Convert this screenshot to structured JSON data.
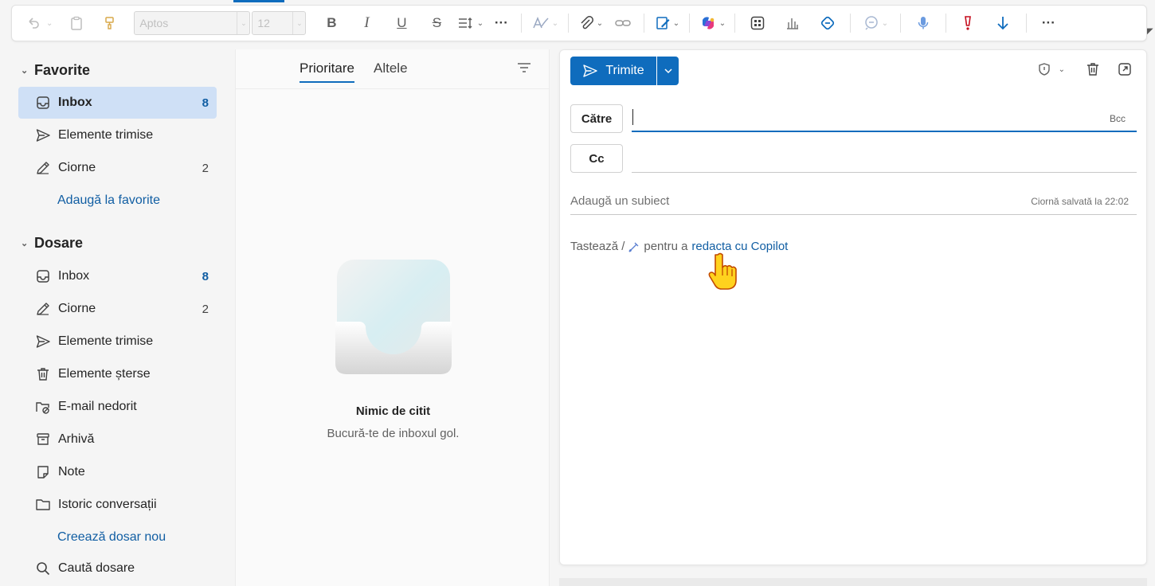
{
  "toolbar": {
    "font_name": "Aptos",
    "font_size": "12",
    "buttons": [
      {
        "name": "undo-icon",
        "disabled": true
      },
      {
        "name": "clipboard-icon",
        "disabled": true
      },
      {
        "name": "format-painter-icon",
        "disabled": true
      },
      {
        "name": "bold-icon",
        "label": "B"
      },
      {
        "name": "italic-icon",
        "label": "I"
      },
      {
        "name": "underline-icon",
        "label": "U"
      },
      {
        "name": "strikethrough-icon",
        "label": "S"
      },
      {
        "name": "paragraph-format-icon"
      },
      {
        "name": "more-formatting-icon",
        "label": "···"
      },
      {
        "name": "editor-icon"
      },
      {
        "name": "attach-icon"
      },
      {
        "name": "link-icon"
      },
      {
        "name": "signature-icon"
      },
      {
        "name": "copilot-icon"
      },
      {
        "name": "apps-icon"
      },
      {
        "name": "insights-icon"
      },
      {
        "name": "loop-icon"
      },
      {
        "name": "immersive-reader-icon"
      },
      {
        "name": "dictate-icon"
      },
      {
        "name": "high-importance-icon"
      },
      {
        "name": "low-importance-icon"
      },
      {
        "name": "more-options-icon",
        "label": "···"
      }
    ],
    "accent": "#0f6cbd"
  },
  "nav": {
    "favorites": {
      "title": "Favorite",
      "items": [
        {
          "label": "Inbox",
          "count": "8",
          "icon": "inbox-icon",
          "selected": true
        },
        {
          "label": "Elemente trimise",
          "count": "",
          "icon": "sent-icon"
        },
        {
          "label": "Ciorne",
          "count": "2",
          "icon": "drafts-icon"
        }
      ],
      "add_link": "Adaugă la favorite"
    },
    "folders": {
      "title": "Dosare",
      "items": [
        {
          "label": "Inbox",
          "count": "8",
          "icon": "inbox-icon"
        },
        {
          "label": "Ciorne",
          "count": "2",
          "icon": "drafts-icon"
        },
        {
          "label": "Elemente trimise",
          "count": "",
          "icon": "sent-icon"
        },
        {
          "label": "Elemente șterse",
          "count": "",
          "icon": "trash-icon"
        },
        {
          "label": "E-mail nedorit",
          "count": "",
          "icon": "junk-icon"
        },
        {
          "label": "Arhivă",
          "count": "",
          "icon": "archive-icon"
        },
        {
          "label": "Note",
          "count": "",
          "icon": "notes-icon"
        },
        {
          "label": "Istoric conversații",
          "count": "",
          "icon": "folder-icon"
        }
      ],
      "new_folder_link": "Creează dosar nou",
      "search_folders": "Caută dosare"
    }
  },
  "message_list": {
    "tabs": [
      {
        "label": "Prioritare",
        "active": true
      },
      {
        "label": "Altele",
        "active": false
      }
    ],
    "empty_title": "Nimic de citit",
    "empty_subtitle": "Bucură-te de inboxul gol."
  },
  "compose": {
    "send_label": "Trimite",
    "to_label": "Către",
    "cc_label": "Cc",
    "bcc_label": "Bcc",
    "subject_placeholder": "Adaugă un subiect",
    "saved_status": "Ciornă salvată la 22:02",
    "body_hint_prefix": "Tastează /",
    "body_hint_middle": "pentru a",
    "body_hint_link": "redacta cu Copilot"
  }
}
